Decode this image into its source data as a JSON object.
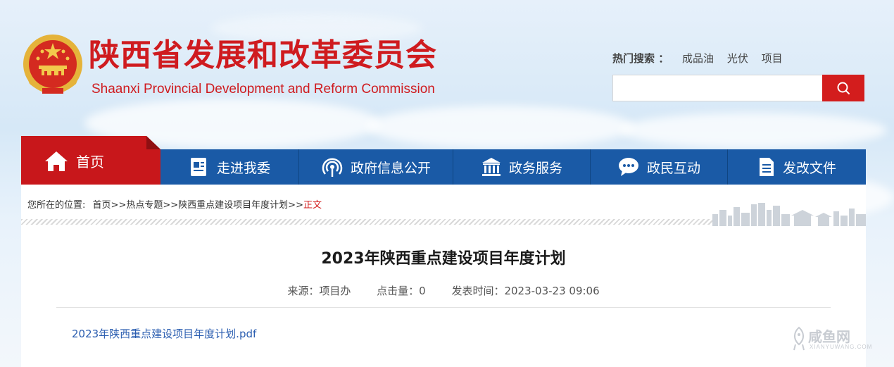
{
  "header": {
    "title_cn": "陕西省发展和改革委员会",
    "title_en": "Shaanxi Provincial Development and Reform Commission",
    "emblem_icon": "national-emblem-icon",
    "accent_color": "#cf1b1f"
  },
  "hot_search": {
    "label": "热门搜索 ：",
    "keywords": [
      "成品油",
      "光伏",
      "项目"
    ]
  },
  "search": {
    "placeholder": "",
    "button_icon": "search-icon"
  },
  "nav": {
    "home": {
      "label": "首页",
      "icon": "home-icon"
    },
    "items": [
      {
        "label": "走进我委",
        "icon": "id-card-icon"
      },
      {
        "label": "政府信息公开",
        "icon": "broadcast-icon"
      },
      {
        "label": "政务服务",
        "icon": "government-building-icon"
      },
      {
        "label": "政民互动",
        "icon": "chat-bubble-icon"
      },
      {
        "label": "发改文件",
        "icon": "document-icon"
      }
    ],
    "bar_color": "#1a5aa6"
  },
  "breadcrumb": {
    "prefix": "您所在的位置:",
    "items": [
      "首页",
      "热点专题",
      "陕西重点建设项目年度计划"
    ],
    "separator": ">>",
    "current": "正文"
  },
  "article": {
    "title": "2023年陕西重点建设项目年度计划",
    "source": "来源：项目办",
    "hits": "点击量：0",
    "published": "发表时间：2023-03-23 09:06",
    "attachment": "2023年陕西重点建设项目年度计划.pdf"
  },
  "watermark": {
    "cn": "咸鱼网",
    "en": "XIANYUWANG.COM"
  }
}
